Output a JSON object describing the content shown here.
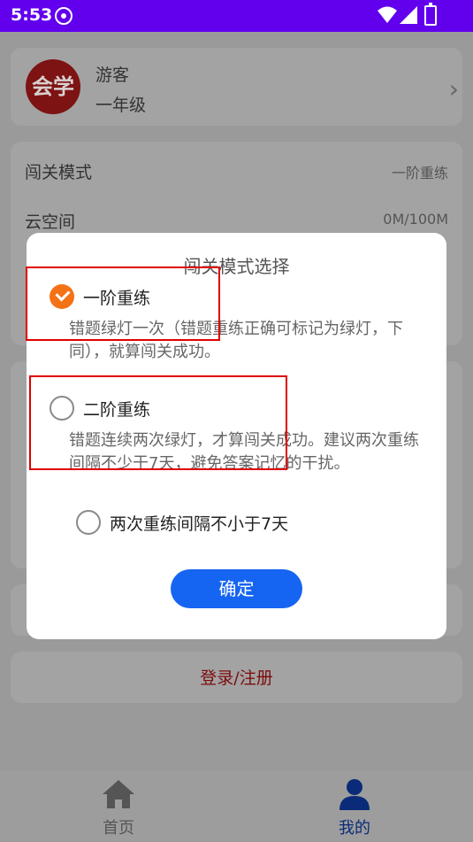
{
  "status_bar": {
    "time": "5:53"
  },
  "profile": {
    "avatar_text": "会学",
    "name": "游客",
    "grade": "一年级"
  },
  "settings": {
    "mode_label": "闯关模式",
    "mode_value": "一阶重练",
    "cloud_label": "云空间",
    "cloud_value": "0M/100M"
  },
  "login": {
    "label": "登录/注册"
  },
  "bottom_nav": {
    "home_label": "首页",
    "mine_label": "我的"
  },
  "dialog": {
    "title": "闯关模式选择",
    "options": [
      {
        "label": "一阶重练",
        "description": "错题绿灯一次（错题重练正确可标记为绿灯，下同），就算闯关成功。",
        "selected": true
      },
      {
        "label": "二阶重练",
        "description": "错题连续两次绿灯，才算闯关成功。建议两次重练间隔不少于7天，避免答案记忆的干扰。",
        "selected": false
      }
    ],
    "interval_option": {
      "label": "两次重练间隔不小于7天",
      "checked": false
    },
    "confirm_label": "确定"
  },
  "colors": {
    "status_bar": "#6200ee",
    "accent": "#f47216",
    "confirm": "#1565f2",
    "highlight": "#e00000",
    "login_text": "#7c0d0d"
  }
}
